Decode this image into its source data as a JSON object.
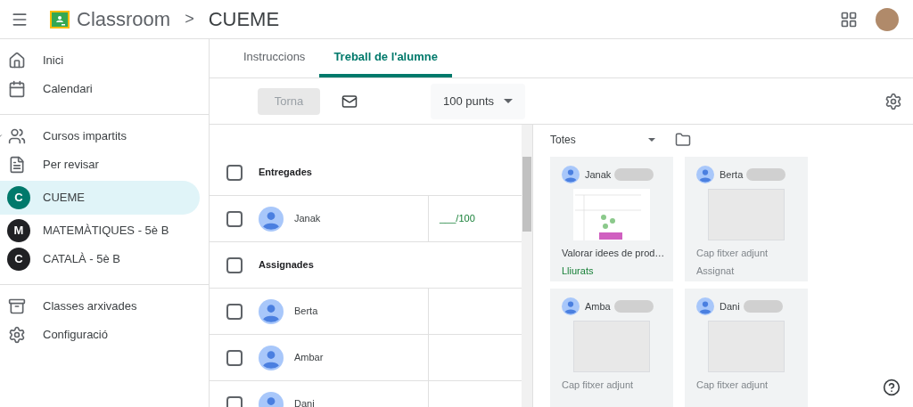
{
  "header": {
    "app": "Classroom",
    "separator": ">",
    "course": "CUEME"
  },
  "sidebar": {
    "groups": [
      [
        {
          "kind": "page",
          "label": "Inici",
          "selected": false
        },
        {
          "kind": "page",
          "label": "Calendari",
          "selected": false
        }
      ],
      [
        {
          "kind": "page",
          "label": "Cursos impartits",
          "selected": false,
          "expanded": true
        },
        {
          "kind": "page",
          "label": "Per revisar",
          "selected": false
        },
        {
          "kind": "course",
          "letter": "C",
          "color": "#00796b",
          "label": "CUEME",
          "selected": true
        },
        {
          "kind": "course",
          "letter": "M",
          "color": "#202124",
          "label": "MATEMÀTIQUES - 5è B",
          "selected": false
        },
        {
          "kind": "course",
          "letter": "C",
          "color": "#202124",
          "label": "CATALÀ - 5è B",
          "selected": false
        }
      ],
      [
        {
          "kind": "page",
          "label": "Classes arxivades",
          "selected": false
        },
        {
          "kind": "page",
          "label": "Configuració",
          "selected": false
        }
      ]
    ]
  },
  "tabs": [
    {
      "label": "Instruccions",
      "selected": false
    },
    {
      "label": "Treball de l'alumne",
      "selected": true
    }
  ],
  "toolbar": {
    "return_button": {
      "label": "Torna",
      "disabled": true
    },
    "points": "100 punts"
  },
  "students": [
    {
      "kind": "group",
      "label": "Entregades",
      "checked": false
    },
    {
      "kind": "student",
      "name": "Janak",
      "checked": false,
      "grade": "___/100"
    },
    {
      "kind": "group",
      "label": "Assignades",
      "checked": false
    },
    {
      "kind": "student",
      "name": "Berta",
      "checked": false
    },
    {
      "kind": "student",
      "name": "Ambar",
      "checked": false
    },
    {
      "kind": "student",
      "name": "Dani",
      "checked": false
    }
  ],
  "filter": "Totes",
  "cards": [
    {
      "name": "Janak",
      "attachment": true,
      "file": "Valorar idees de prod…",
      "status": "Lliurats",
      "turned_in": true
    },
    {
      "name": "Berta",
      "attachment": false,
      "file": "Cap fitxer adjunt",
      "status": "Assignat",
      "turned_in": false
    },
    {
      "name": "Amba",
      "attachment": false,
      "file": "Cap fitxer adjunt"
    },
    {
      "name": "Dani",
      "attachment": false,
      "file": "Cap fitxer adjunt"
    }
  ]
}
